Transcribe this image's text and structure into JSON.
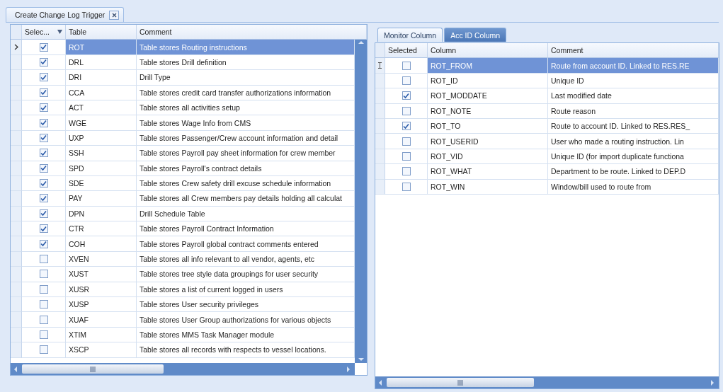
{
  "document_tab": {
    "title": "Create Change Log Trigger"
  },
  "table_grid": {
    "columns": [
      "Selec...",
      "Table",
      "Comment"
    ],
    "rows": [
      {
        "table": "ROT",
        "comment": "Table stores Routing instructions",
        "checked": true,
        "selected": true
      },
      {
        "table": "DRL",
        "comment": "Table stores Drill definition",
        "checked": true,
        "selected": false
      },
      {
        "table": "DRI",
        "comment": "Drill Type",
        "checked": true,
        "selected": false
      },
      {
        "table": "CCA",
        "comment": "Table stores credit card transfer authorizations information",
        "checked": true,
        "selected": false
      },
      {
        "table": "ACT",
        "comment": "Table stores all activities setup",
        "checked": true,
        "selected": false
      },
      {
        "table": "WGE",
        "comment": "Table stores Wage Info from CMS",
        "checked": true,
        "selected": false
      },
      {
        "table": "UXP",
        "comment": "Table stores Passenger/Crew account information and detail",
        "checked": true,
        "selected": false
      },
      {
        "table": "SSH",
        "comment": "Table stores Payroll pay sheet information for crew member",
        "checked": true,
        "selected": false
      },
      {
        "table": "SPD",
        "comment": "Table stores Payroll's contract details",
        "checked": true,
        "selected": false
      },
      {
        "table": "SDE",
        "comment": "Table stores Crew safety drill excuse schedule information",
        "checked": true,
        "selected": false
      },
      {
        "table": "PAY",
        "comment": "Table stores all Crew members pay details holding all calculat",
        "checked": true,
        "selected": false
      },
      {
        "table": "DPN",
        "comment": "Drill Schedule Table",
        "checked": true,
        "selected": false
      },
      {
        "table": "CTR",
        "comment": "Table stores Payroll Contract Information",
        "checked": true,
        "selected": false
      },
      {
        "table": "COH",
        "comment": "Table stores Payroll global contract comments entered",
        "checked": true,
        "selected": false
      },
      {
        "table": "XVEN",
        "comment": "Table stores all info relevant to all vendor, agents, etc",
        "checked": false,
        "selected": false
      },
      {
        "table": "XUST",
        "comment": "Table stores tree style data groupings for user security",
        "checked": false,
        "selected": false
      },
      {
        "table": "XUSR",
        "comment": "Table stores a list of current logged in users",
        "checked": false,
        "selected": false
      },
      {
        "table": "XUSP",
        "comment": "Table stores User security privileges",
        "checked": false,
        "selected": false
      },
      {
        "table": "XUAF",
        "comment": "Table stores User Group authorizations for various objects",
        "checked": false,
        "selected": false
      },
      {
        "table": "XTIM",
        "comment": "Table stores MMS Task Manager module",
        "checked": false,
        "selected": false
      },
      {
        "table": "XSCP",
        "comment": "Table stores all records with respects to vessel locations.",
        "checked": false,
        "selected": false
      }
    ]
  },
  "column_tabs": [
    {
      "label": "Monitor Column",
      "selected": true
    },
    {
      "label": "Acc ID Column",
      "selected": false
    }
  ],
  "column_grid": {
    "columns": [
      "Selected",
      "Column",
      "Comment"
    ],
    "rows": [
      {
        "column": "ROT_FROM",
        "comment": "Route from account ID. Linked to RES.RE",
        "checked": false,
        "selected": true
      },
      {
        "column": "ROT_ID",
        "comment": "Unique ID",
        "checked": false,
        "selected": false
      },
      {
        "column": "ROT_MODDATE",
        "comment": "Last modified date",
        "checked": true,
        "selected": false
      },
      {
        "column": "ROT_NOTE",
        "comment": "Route reason",
        "checked": false,
        "selected": false
      },
      {
        "column": "ROT_TO",
        "comment": "Route to account ID. Linked to RES.RES_",
        "checked": true,
        "selected": false
      },
      {
        "column": "ROT_USERID",
        "comment": "User who made a routing instruction. Lin",
        "checked": false,
        "selected": false
      },
      {
        "column": "ROT_VID",
        "comment": "Unique ID (for import duplicate functiona",
        "checked": false,
        "selected": false
      },
      {
        "column": "ROT_WHAT",
        "comment": "Department to be route. Linked to DEP.D",
        "checked": false,
        "selected": false
      },
      {
        "column": "ROT_WIN",
        "comment": "Window/bill used to route from",
        "checked": false,
        "selected": false
      }
    ]
  }
}
